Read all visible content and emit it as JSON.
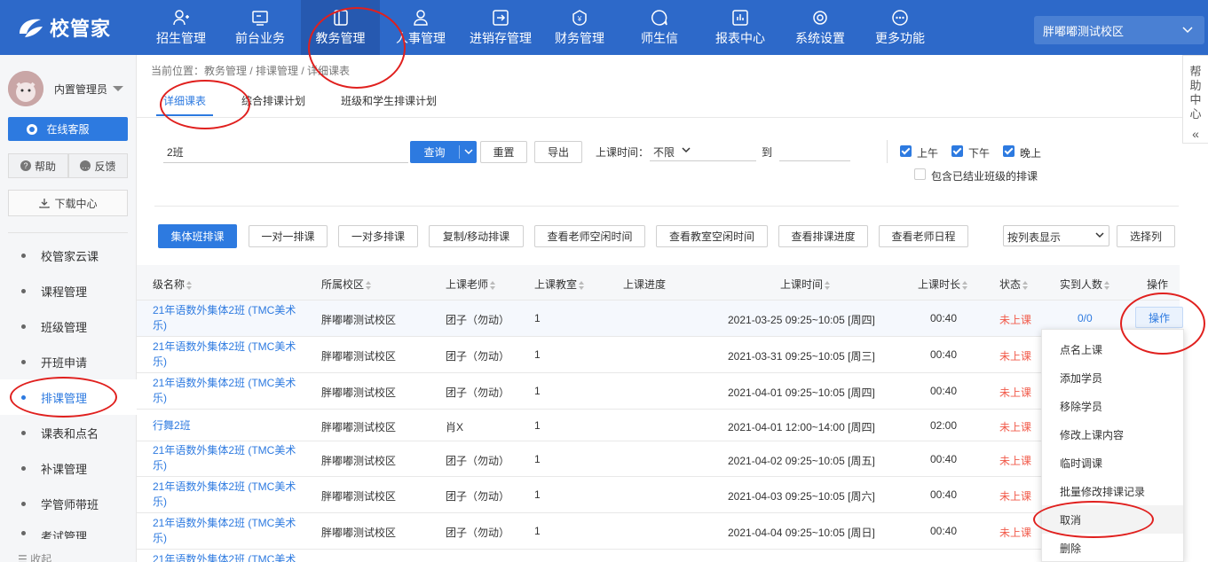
{
  "app": {
    "name": "校管家"
  },
  "nav": [
    {
      "label": "招生管理",
      "icon": "user-plus-icon"
    },
    {
      "label": "前台业务",
      "icon": "monitor-icon"
    },
    {
      "label": "教务管理",
      "icon": "book-icon",
      "active": true
    },
    {
      "label": "人事管理",
      "icon": "person-icon"
    },
    {
      "label": "进销存管理",
      "icon": "exchange-icon"
    },
    {
      "label": "财务管理",
      "icon": "money-bag-icon"
    },
    {
      "label": "师生信",
      "icon": "chat-icon"
    },
    {
      "label": "报表中心",
      "icon": "report-icon"
    },
    {
      "label": "系统设置",
      "icon": "settings-icon"
    },
    {
      "label": "更多功能",
      "icon": "more-icon"
    }
  ],
  "campus": "胖嘟嘟测试校区",
  "user": {
    "name": "内置管理员"
  },
  "sidebar": {
    "online_service": "在线客服",
    "help": "帮助",
    "feedback": "反馈",
    "download": "下载中心",
    "items": [
      "校管家云课",
      "课程管理",
      "班级管理",
      "开班申请",
      "排课管理",
      "课表和点名",
      "补课管理",
      "学管师带班",
      "考试管理"
    ],
    "active_index": 4,
    "collapse": "收起"
  },
  "breadcrumb": "当前位置：教务管理 / 排课管理 / 详细课表",
  "tabs": [
    "详细课表",
    "综合排课计划",
    "班级和学生排课计划"
  ],
  "filters": {
    "search_value": "2班",
    "query": "查询",
    "reset": "重置",
    "export": "导出",
    "time_label": "上课时间：",
    "time_value": "不限",
    "to": "到",
    "morning": "上午",
    "afternoon": "下午",
    "evening": "晚上",
    "include_closed": "包含已结业班级的排课"
  },
  "actions": {
    "group": "集体班排课",
    "one_to_one": "一对一排课",
    "one_to_many": "一对多排课",
    "copy_move": "复制/移动排课",
    "teacher_free": "查看老师空闲时间",
    "room_free": "查看教室空闲时间",
    "progress": "查看排课进度",
    "teacher_schedule": "查看老师日程",
    "view_mode": "按列表显示",
    "choose_cols": "选择列"
  },
  "help_panel": "帮助中心",
  "table": {
    "headers": [
      "级名称",
      "所属校区",
      "上课老师",
      "上课教室",
      "上课进度",
      "上课时间",
      "上课时长",
      "状态",
      "实到人数",
      "操作"
    ],
    "rows": [
      {
        "name": "21年语数外集体2班 (TMC美术乐)",
        "campus": "胖嘟嘟测试校区",
        "teacher": "团子（勿动）",
        "room": "1",
        "time": "2021-03-25 09:25~10:05 [周四]",
        "duration": "00:40",
        "status": "未上课",
        "attend": "0/0",
        "op": "操作"
      },
      {
        "name": "21年语数外集体2班 (TMC美术乐)",
        "campus": "胖嘟嘟测试校区",
        "teacher": "团子（勿动）",
        "room": "1",
        "time": "2021-03-31 09:25~10:05 [周三]",
        "duration": "00:40",
        "status": "未上课"
      },
      {
        "name": "21年语数外集体2班 (TMC美术乐)",
        "campus": "胖嘟嘟测试校区",
        "teacher": "团子（勿动）",
        "room": "1",
        "time": "2021-04-01 09:25~10:05 [周四]",
        "duration": "00:40",
        "status": "未上课"
      },
      {
        "name": "行舞2班",
        "campus": "胖嘟嘟测试校区",
        "teacher": "肖X",
        "room": "1",
        "time": "2021-04-01 12:00~14:00 [周四]",
        "duration": "02:00",
        "status": "未上课"
      },
      {
        "name": "21年语数外集体2班 (TMC美术乐)",
        "campus": "胖嘟嘟测试校区",
        "teacher": "团子（勿动）",
        "room": "1",
        "time": "2021-04-02 09:25~10:05 [周五]",
        "duration": "00:40",
        "status": "未上课"
      },
      {
        "name": "21年语数外集体2班 (TMC美术乐)",
        "campus": "胖嘟嘟测试校区",
        "teacher": "团子（勿动）",
        "room": "1",
        "time": "2021-04-03 09:25~10:05 [周六]",
        "duration": "00:40",
        "status": "未上课"
      },
      {
        "name": "21年语数外集体2班 (TMC美术乐)",
        "campus": "胖嘟嘟测试校区",
        "teacher": "团子（勿动）",
        "room": "1",
        "time": "2021-04-04 09:25~10:05 [周日]",
        "duration": "00:40",
        "status": "未上课"
      },
      {
        "name": "21年语数外集体2班 (TMC美术",
        "campus": "",
        "teacher": "",
        "room": "",
        "time": "",
        "duration": "",
        "status": ""
      }
    ]
  },
  "menu": [
    "点名上课",
    "添加学员",
    "移除学员",
    "修改上课内容",
    "临时调课",
    "批量修改排课记录",
    "取消",
    "删除"
  ],
  "colors": {
    "primary": "#2d69c9",
    "accent": "#2d7ae0",
    "status": "#f15a4a",
    "annotation": "#e0201e"
  }
}
